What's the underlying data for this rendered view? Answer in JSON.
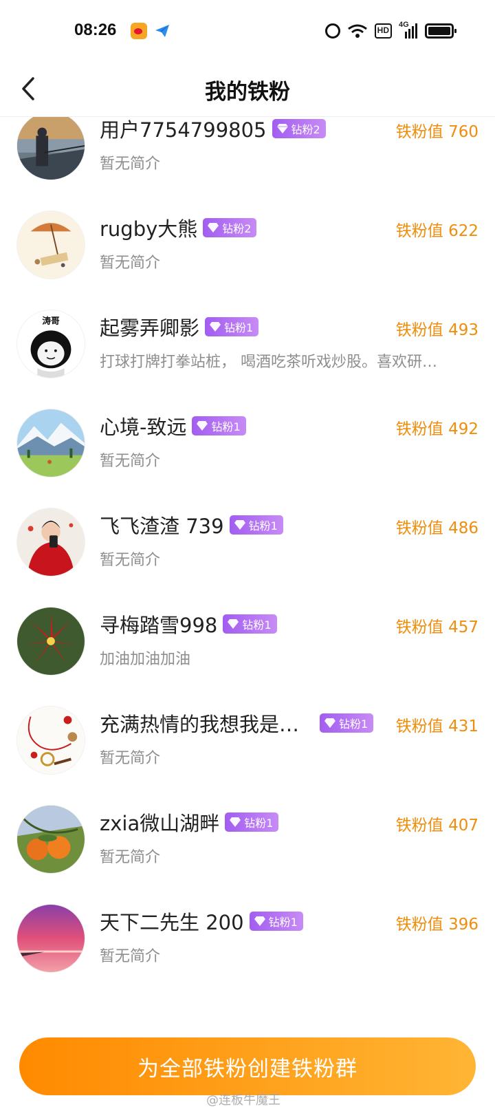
{
  "status_bar": {
    "time": "08:26",
    "network": "4G"
  },
  "header": {
    "title": "我的铁粉"
  },
  "fans": [
    {
      "name": "用户7754799805",
      "badge": "钻粉2",
      "bio": "暂无简介",
      "score_label": "铁粉值",
      "score": "760"
    },
    {
      "name": "rugby大熊",
      "badge": "钻粉2",
      "bio": "暂无简介",
      "score_label": "铁粉值",
      "score": "622"
    },
    {
      "name": "起雾弄卿影",
      "badge": "钻粉1",
      "bio": "打球打牌打拳站桩， 喝酒吃茶听戏炒股。喜欢研…",
      "score_label": "铁粉值",
      "score": "493"
    },
    {
      "name": "心境-致远",
      "badge": "钻粉1",
      "bio": "暂无简介",
      "score_label": "铁粉值",
      "score": "492"
    },
    {
      "name": "飞飞渣渣 739",
      "badge": "钻粉1",
      "bio": "暂无简介",
      "score_label": "铁粉值",
      "score": "486"
    },
    {
      "name": "寻梅踏雪998",
      "badge": "钻粉1",
      "bio": "加油加油加油",
      "score_label": "铁粉值",
      "score": "457"
    },
    {
      "name": "充满热情的我想我是…",
      "badge": "钻粉1",
      "bio": "暂无简介",
      "score_label": "铁粉值",
      "score": "431"
    },
    {
      "name": "zxia微山湖畔",
      "badge": "钻粉1",
      "bio": "暂无简介",
      "score_label": "铁粉值",
      "score": "407"
    },
    {
      "name": "天下二先生 200",
      "badge": "钻粉1",
      "bio": "暂无简介",
      "score_label": "铁粉值",
      "score": "396"
    }
  ],
  "avatar_text": {
    "tao_ge": "涛哥"
  },
  "footer": {
    "create_button": "为全部铁粉创建铁粉群"
  },
  "watermark": "@连板牛魔王",
  "colors": {
    "accent": "#f08d0c",
    "badge": "#a25df0",
    "button": "#ff8a00"
  }
}
